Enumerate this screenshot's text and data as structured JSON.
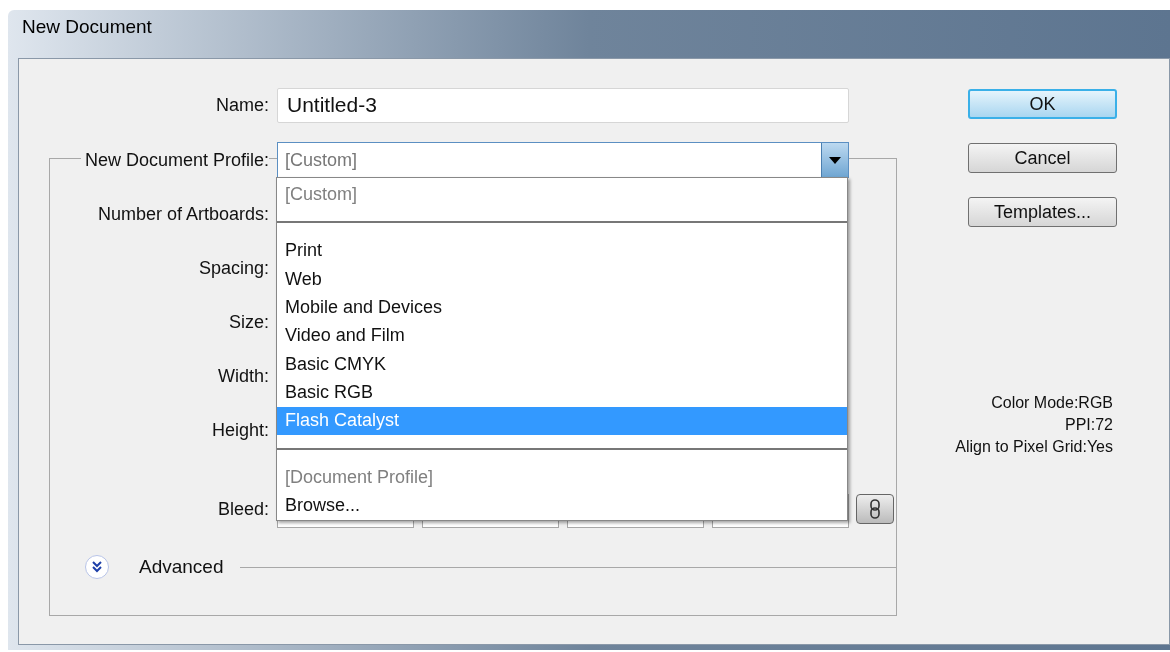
{
  "window": {
    "title": "New Document"
  },
  "name": {
    "label": "Name:",
    "value": "Untitled-3"
  },
  "profile": {
    "label": "New Document Profile:",
    "value": "[Custom]",
    "expanded": true
  },
  "profile_options": [
    {
      "kind": "option",
      "label": "[Custom]",
      "disabled": true,
      "selected": false
    },
    {
      "kind": "separator"
    },
    {
      "kind": "option",
      "label": "Print",
      "disabled": false,
      "selected": false
    },
    {
      "kind": "option",
      "label": "Web",
      "disabled": false,
      "selected": false
    },
    {
      "kind": "option",
      "label": "Mobile and Devices",
      "disabled": false,
      "selected": false
    },
    {
      "kind": "option",
      "label": "Video and Film",
      "disabled": false,
      "selected": false
    },
    {
      "kind": "option",
      "label": "Basic CMYK",
      "disabled": false,
      "selected": false
    },
    {
      "kind": "option",
      "label": "Basic RGB",
      "disabled": false,
      "selected": false
    },
    {
      "kind": "option",
      "label": "Flash Catalyst",
      "disabled": false,
      "selected": true
    },
    {
      "kind": "separator"
    },
    {
      "kind": "option",
      "label": "[Document Profile]",
      "disabled": true,
      "selected": false
    },
    {
      "kind": "option",
      "label": "Browse...",
      "disabled": false,
      "selected": false
    }
  ],
  "field_labels": [
    "Number of Artboards:",
    "Spacing:",
    "Size:",
    "Width:",
    "Height:"
  ],
  "bleed": {
    "label": "Bleed:"
  },
  "advanced": {
    "label": "Advanced",
    "expanded": false
  },
  "buttons": [
    {
      "label": "OK",
      "default": true
    },
    {
      "label": "Cancel",
      "default": false
    },
    {
      "label": "Templates...",
      "default": false
    }
  ],
  "info": [
    "Color Mode:RGB",
    "PPI:72",
    "Align to Pixel Grid:Yes"
  ]
}
